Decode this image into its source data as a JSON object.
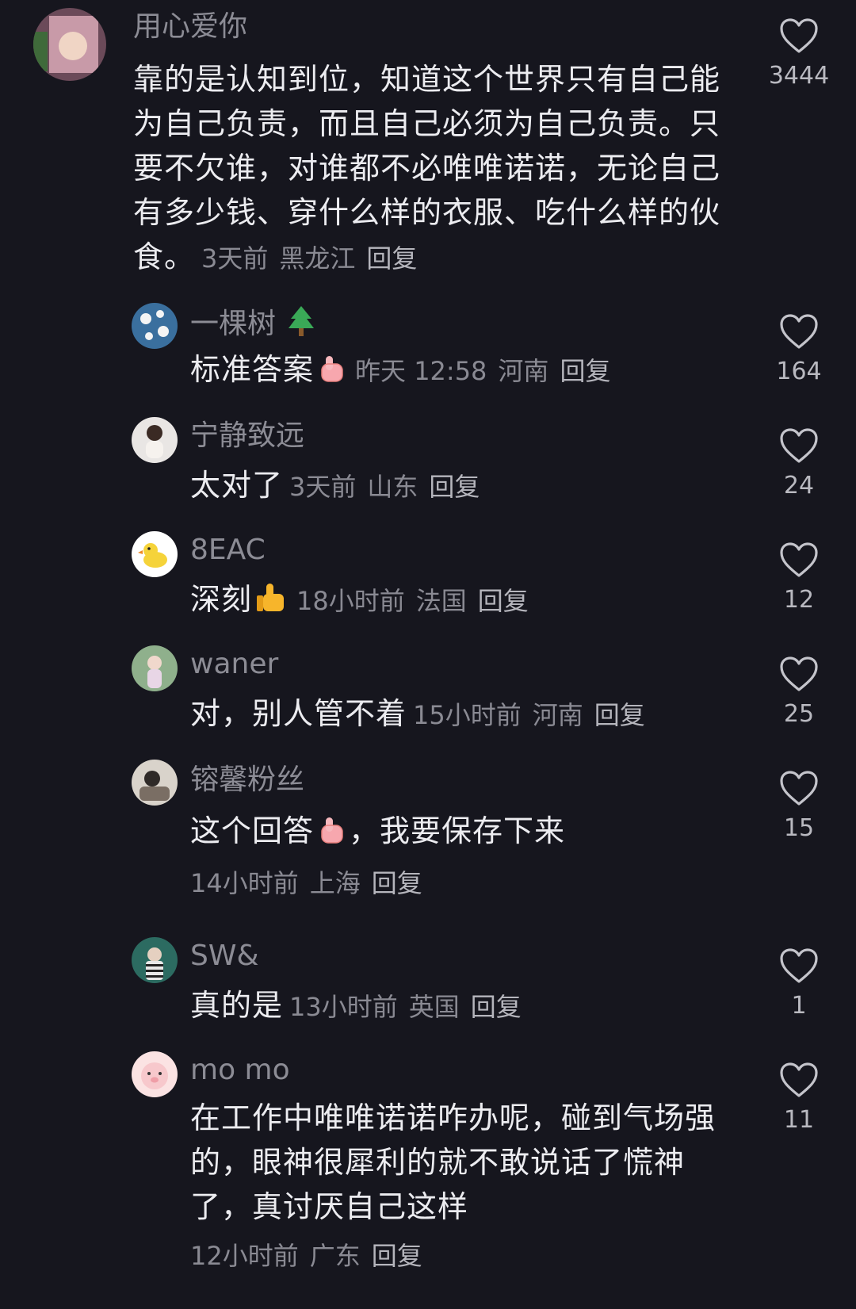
{
  "comments": [
    {
      "username": "用心爱你",
      "text": "靠的是认知到位，知道这个世界只有自己能为自己负责，而且自己必须为自己负责。只要不欠谁，对谁都不必唯唯诺诺，无论自己有多少钱、穿什么样的衣服、吃什么样的伙食。",
      "time": "3天前",
      "location": "黑龙江",
      "reply": "回复",
      "likes": "3444"
    },
    {
      "username": "一棵树",
      "text": "标准答案",
      "time": "昨天 12:58",
      "location": "河南",
      "reply": "回复",
      "likes": "164"
    },
    {
      "username": "宁静致远",
      "text": "太对了",
      "time": "3天前",
      "location": "山东",
      "reply": "回复",
      "likes": "24"
    },
    {
      "username": "8EAC",
      "text": "深刻",
      "time": "18小时前",
      "location": "法国",
      "reply": "回复",
      "likes": "12"
    },
    {
      "username": "waner",
      "text": "对，别人管不着",
      "time": "15小时前",
      "location": "河南",
      "reply": "回复",
      "likes": "25"
    },
    {
      "username": "镕馨粉丝",
      "text_before_emoji": "这个回答",
      "text_after_emoji": "，我要保存下来",
      "time": "14小时前",
      "location": "上海",
      "reply": "回复",
      "likes": "15"
    },
    {
      "username": "SW&",
      "text": "真的是",
      "time": "13小时前",
      "location": "英国",
      "reply": "回复",
      "likes": "1"
    },
    {
      "username": "mo mo",
      "text": "在工作中唯唯诺诺咋办呢，碰到气场强的，眼神很犀利的就不敢说话了慌神了，真讨厌自己这样",
      "time": "12小时前",
      "location": "广东",
      "reply": "回复",
      "likes": "11"
    }
  ],
  "icons": {
    "like": "heart-outline-icon",
    "tree": "tree-emoji-icon",
    "thumbs_up": "thumbs-up-emoji-icon",
    "pink_thumb": "pink-thumbs-up-emoji-icon"
  },
  "colors": {
    "background": "#16161e",
    "text": "#ececf0",
    "muted": "#8a8a93"
  }
}
